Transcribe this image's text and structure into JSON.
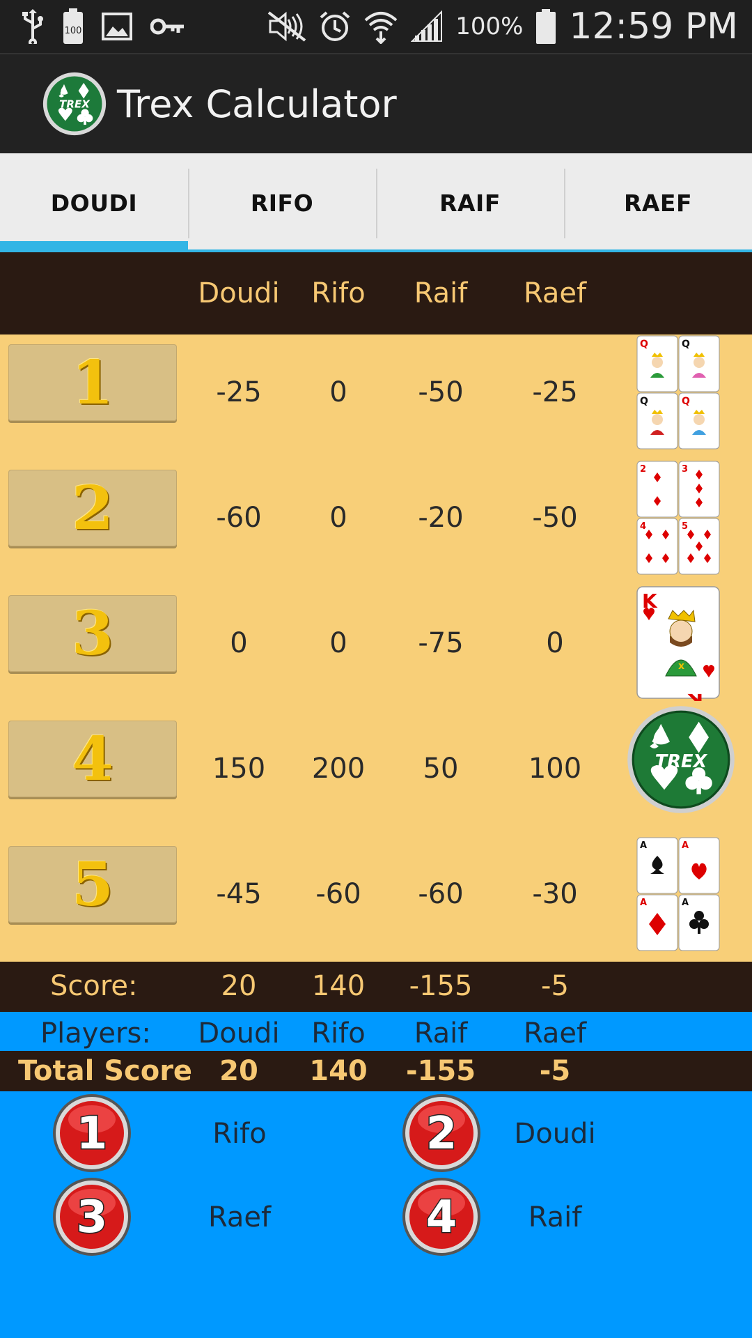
{
  "status_bar": {
    "battery_level": "100",
    "battery_percent": "100%",
    "time": "12:59 PM",
    "icons": [
      "usb-icon",
      "battery-saver-icon",
      "image-icon",
      "key-icon",
      "mute-icon",
      "alarm-icon",
      "wifi-icon",
      "signal-icon",
      "battery-icon"
    ]
  },
  "app_bar": {
    "title": "Trex Calculator",
    "logo_text": "TREX"
  },
  "tabs": [
    {
      "label": "DOUDI",
      "active": true
    },
    {
      "label": "RIFO",
      "active": false
    },
    {
      "label": "RAIF",
      "active": false
    },
    {
      "label": "RAEF",
      "active": false
    }
  ],
  "players": [
    "Doudi",
    "Rifo",
    "Raif",
    "Raef"
  ],
  "rounds": [
    {
      "number": "1",
      "scores": [
        "-25",
        "0",
        "-50",
        "-25"
      ],
      "icon": "four-queens-cards-icon"
    },
    {
      "number": "2",
      "scores": [
        "-60",
        "0",
        "-20",
        "-50"
      ],
      "icon": "diamond-cards-icon"
    },
    {
      "number": "3",
      "scores": [
        "0",
        "0",
        "-75",
        "0"
      ],
      "icon": "king-of-hearts-card-icon"
    },
    {
      "number": "4",
      "scores": [
        "150",
        "200",
        "50",
        "100"
      ],
      "icon": "trex-logo-icon"
    },
    {
      "number": "5",
      "scores": [
        "-45",
        "-60",
        "-60",
        "-30"
      ],
      "icon": "four-aces-cards-icon"
    }
  ],
  "score": {
    "label": "Score:",
    "values": [
      "20",
      "140",
      "-155",
      "-5"
    ]
  },
  "players_row": {
    "label": "Players:",
    "names": [
      "Doudi",
      "Rifo",
      "Raif",
      "Raef"
    ]
  },
  "total": {
    "label": "Total Score",
    "values": [
      "20",
      "140",
      "-155",
      "-5"
    ]
  },
  "ranking": [
    {
      "place": "1",
      "name": "Rifo"
    },
    {
      "place": "2",
      "name": "Doudi"
    },
    {
      "place": "3",
      "name": "Raef"
    },
    {
      "place": "4",
      "name": "Raif"
    }
  ],
  "colors": {
    "status_bar": "#1f1f1f",
    "action_bar": "#222222",
    "tab_bg": "#ececec",
    "tab_indicator": "#33b5e5",
    "header_brown": "#2a1a12",
    "header_text": "#f7c873",
    "table_bg": "#f8cf78",
    "button_bg": "#d8bf85",
    "footer_blue": "#0099ff",
    "rank_red": "#d92020"
  }
}
